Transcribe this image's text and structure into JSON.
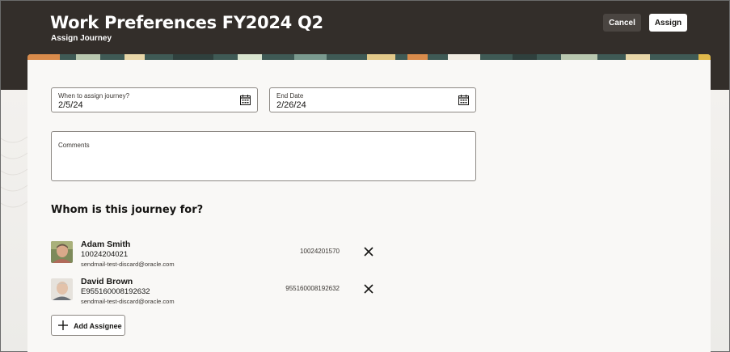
{
  "header": {
    "title": "Work Preferences FY2024 Q2",
    "subtitle": "Assign Journey",
    "cancel_label": "Cancel",
    "assign_label": "Assign"
  },
  "form": {
    "when": {
      "label": "When to assign journey?",
      "value": "2/5/24",
      "icon": "calendar-icon"
    },
    "end": {
      "label": "End Date",
      "value": "2/26/24",
      "icon": "calendar-icon"
    },
    "comments": {
      "label": "Comments",
      "value": ""
    }
  },
  "assignees_section": {
    "title": "Whom is this journey for?",
    "items": [
      {
        "name": "Adam Smith",
        "id": "10024204021",
        "email": "sendmail-test-discard@oracle.com",
        "number": "10024201570",
        "remove_icon": "close-icon"
      },
      {
        "name": "David Brown",
        "id": "E955160008192632",
        "email": "sendmail-test-discard@oracle.com",
        "number": "955160008192632",
        "remove_icon": "close-icon"
      }
    ],
    "add_label": "Add Assignee",
    "add_icon": "plus-icon"
  },
  "colors": {
    "header_bg": "#332e2a",
    "panel_bg": "#f9f8f6",
    "page_bg": "#efedea"
  }
}
